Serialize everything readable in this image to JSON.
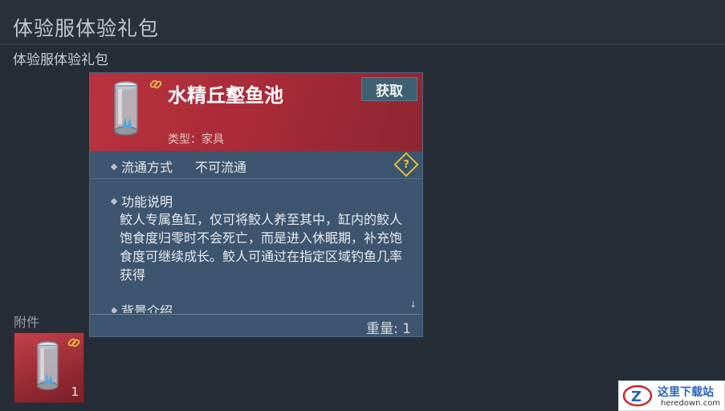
{
  "header": {
    "title": "体验服体验礼包"
  },
  "mail": {
    "subject": "体验服体验礼包",
    "attachments_label": "附件",
    "attachment": {
      "icon": "jar-icon",
      "count": "1"
    }
  },
  "tooltip": {
    "item_name": "水精丘壑鱼池",
    "obtain_label": "获取",
    "type_text": "类型：家具",
    "circulation_label": "流通方式",
    "circulation_value": "不可流通",
    "function_heading": "功能说明",
    "function_text": "鲛人专属鱼缸，仅可将鲛人养至其中，缸内的鲛人饱食度归零时不会死亡，而是进入休眠期，补充饱食度可继续成长。鲛人可通过在指定区域钓鱼几率获得",
    "background_heading": "背景介绍",
    "weight_text": "重量: 1"
  },
  "watermark": {
    "name": "这里下载站",
    "url": "heredown.com"
  },
  "colors": {
    "rarity_red": "#b8333f",
    "panel_blue": "#3d556e",
    "help_yellow": "#e0c03a"
  }
}
